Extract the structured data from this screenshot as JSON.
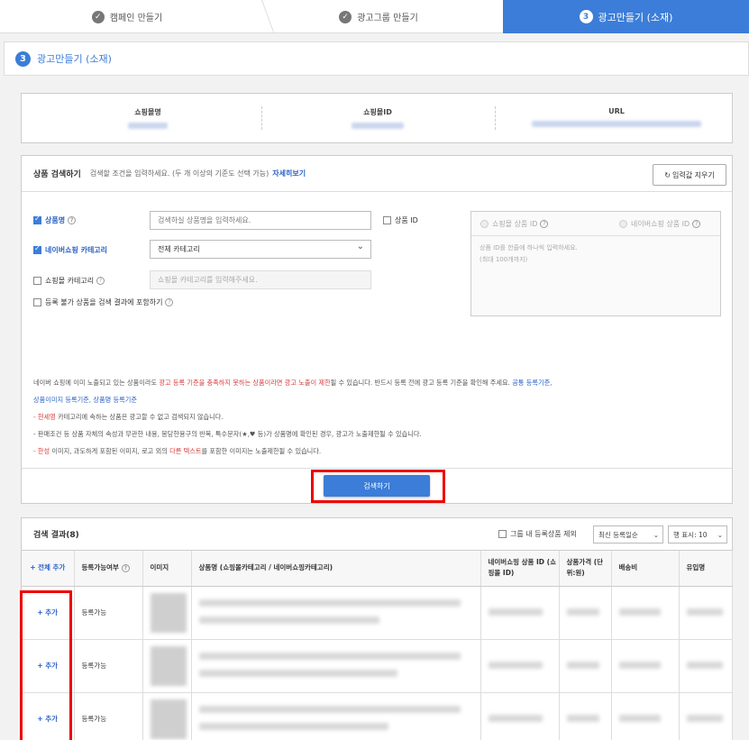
{
  "steps": [
    {
      "label": "캠페인 만들기",
      "state": "done"
    },
    {
      "label": "광고그룹 만들기",
      "state": "done"
    },
    {
      "label": "광고만들기 (소재)",
      "state": "active",
      "num": "3"
    }
  ],
  "page_title": {
    "num": "3",
    "label": "광고만들기 (소재)"
  },
  "info": {
    "shop_name_label": "쇼핑몰명",
    "shop_id_label": "쇼핑몰ID",
    "url_label": "URL"
  },
  "search": {
    "title": "상품 검색하기",
    "hint": "검색할 조건을 입력하세요. (두 개 이상의 기준도 선택 가능)",
    "more": "자세히보기",
    "reset": "입력값 지우기",
    "product_name_label": "상품명",
    "product_name_placeholder": "검색하실 상품명을 입력하세요.",
    "product_id_label": "상품 ID",
    "naver_category_label": "네이버쇼핑 카테고리",
    "naver_category_value": "전체 카테고리",
    "mall_category_label": "쇼핑몰 카테고리",
    "mall_category_placeholder": "쇼핑몰 카테고리를 입력해주세요.",
    "include_unregistrable_label": "등록 불가 상품을 검색 결과에 포함하기",
    "mall_product_id_label": "쇼핑몰 상품 ID",
    "naver_product_id_label": "네이버쇼핑 상품 ID",
    "id_desc_1": "상품 ID를 한줄에 하나씩 입력하세요.",
    "id_desc_2": "(최대 100개까지)",
    "notice": {
      "line1_a": "네이버 쇼핑에 이미 노출되고 있는 상품이라도 ",
      "line1_red": "광고 등록 기준을 충족하지 못하는 상품이라면 광고 노출이 제한",
      "line1_b": "될 수 있습니다. 반드시 등록 전에 광고 등록 기준을 확인해 주세요. ",
      "line1_link": "공통 등록기준,",
      "line2_link": "상품이미지 등록기준, 상품명 등록기준",
      "line3_red": "- 현세영",
      "line3": " 카테고리에 속하는 상품은 광고할 수 없고 검색되지 않습니다.",
      "line4": "- 판매조건 등 상품 자체의 속성과 무관한 내용, 몽당한용구의 반복, 특수문자(★,♥ 등)가 상품명에 확인된 경우, 광고가 노출제한될 수 있습니다.",
      "line5_red": "- 한성",
      "line5_a": " 이미지, 과도하게 포함된 이미지, 로고 외의 ",
      "line5_red2": "다른 텍스트",
      "line5_b": "를 포함한 이미지는 노출제한될 수 있습니다."
    },
    "search_button": "검색하기"
  },
  "results": {
    "title": "검색 결과(8)",
    "exclude_label": "그룹 내 등록상품 제외",
    "sort_value": "최신 등록일순",
    "page_size_value": "행 표시: 10",
    "columns": [
      "+ 전체 추가",
      "등록가능여부",
      "이미지",
      "상품명 (쇼핑몰카테고리 / 네이버쇼핑카테고리)",
      "네이버쇼핑 상품 ID (쇼핑몰 ID)",
      "상품가격 (단위:원)",
      "배송비",
      "유입명"
    ],
    "rows": [
      {
        "add": "+ 추가",
        "status": "등록가능"
      },
      {
        "add": "+ 추가",
        "status": "등록가능"
      },
      {
        "add": "+ 추가",
        "status": "등록가능"
      }
    ]
  }
}
